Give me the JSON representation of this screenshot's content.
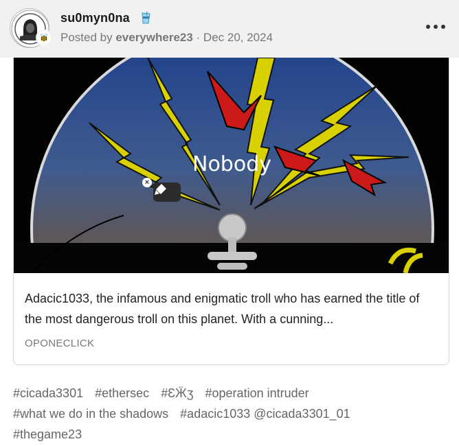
{
  "header": {
    "username": "su0myn0na",
    "posted_prefix": "Posted by ",
    "posted_by": "everywhere23",
    "separator": " · ",
    "date": "Dec 20, 2024",
    "avatar_icon": "anonymous-mask-icon",
    "sub_avatar_icon": "bee-icon",
    "badge_icon": "drink-cup-badge-icon",
    "more_icon": "more-horizontal-icon"
  },
  "card": {
    "image_title": "Nobody",
    "image_icon": "lightning-bolts-emblem-image",
    "close_icon": "close-icon",
    "highlight_icon": "highlighter-pen-icon",
    "description": "Adacic1033, the infamous and enigmatic troll who has earned the title of the most dangerous troll on this planet. With a cunning...",
    "source": "OPONECLICK"
  },
  "tags": [
    "#cicada3301",
    "#ethersec",
    "#ƐӜʒ",
    "#operation intruder",
    "#what we do in the shadows",
    "#adacic1033 @cicada3301_01",
    "#thegame23"
  ],
  "colors": {
    "header_bg": "#f1f1f1",
    "text_muted": "#777777",
    "tag_text": "#666666",
    "bolt_yellow": "#d8d000",
    "arrow_red": "#cc1a1a"
  }
}
